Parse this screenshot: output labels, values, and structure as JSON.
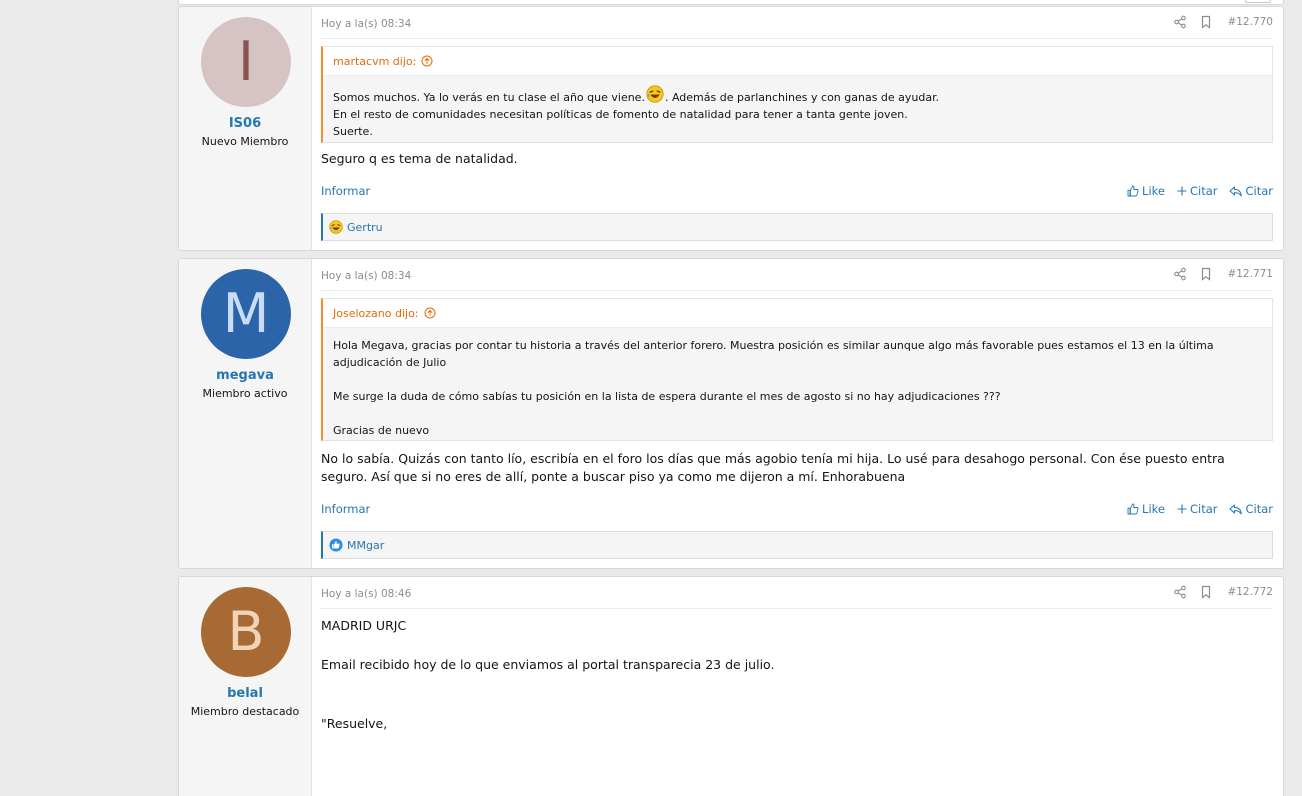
{
  "colors": {
    "link": "#2577b1",
    "quote_accent": "#f78c2b",
    "quote_author": "#e36c09",
    "meta": "#8c8c8c"
  },
  "posts": [
    {
      "avatar_letter": "I",
      "avatar_bg": "#d6c3c3",
      "avatar_fg": "#8a5353",
      "username": "IS06",
      "user_title": "Nuevo Miembro",
      "date": "Hoy a la(s) 08:34",
      "number": "#12.770",
      "quote": {
        "author": "martacvm dijo:",
        "line1a": "Somos muchos. Ya lo verás en tu clase el año que viene.",
        "line1b": ". Además de parlanchines y con ganas de ayudar.",
        "line2": "En el resto de comunidades necesitan políticas de fomento de natalidad para tener a tanta gente joven.",
        "line3": "Suerte."
      },
      "body": "Seguro q es tema de natalidad.",
      "report": "Informar",
      "like": "Like",
      "quote_add": "Citar",
      "reply": "Citar",
      "reaction_user": "Gertru",
      "reaction_icon": "laugh-icon"
    },
    {
      "avatar_letter": "M",
      "avatar_bg": "#2b64a8",
      "avatar_fg": "#c8dcf3",
      "username": "megava",
      "user_title": "Miembro activo",
      "date": "Hoy a la(s) 08:34",
      "number": "#12.771",
      "quote": {
        "author": "Joselozano dijo:",
        "p1": "Hola Megava, gracias por contar tu historia a través del anterior forero. Muestra posición es similar aunque algo más favorable pues estamos el 13 en la última adjudicación de Julio",
        "p2": "Me surge la duda de cómo sabías tu posición en la lista de espera durante el mes de agosto si no hay adjudicaciones ???",
        "p3": "Gracias de nuevo"
      },
      "body": "No lo sabía. Quizás con tanto lío, escribía en el foro los días que más agobio tenía mi hija. Lo usé para desahogo personal. Con ése puesto entra seguro. Así que si no eres de allí, ponte a buscar piso ya como me dijeron a mí. Enhorabuena",
      "report": "Informar",
      "like": "Like",
      "quote_add": "Citar",
      "reply": "Citar",
      "reaction_user": "MMgar",
      "reaction_icon": "thumbs-up-icon"
    },
    {
      "avatar_letter": "B",
      "avatar_bg": "#a86a35",
      "avatar_fg": "#f1d4b6",
      "username": "belal",
      "user_title": "Miembro destacado",
      "date": "Hoy a la(s) 08:46",
      "number": "#12.772",
      "body_p1": "MADRID URJC",
      "body_p2": "Email recibido hoy de lo que enviamos al portal transparecia 23 de julio.",
      "body_p3": "\"Resuelve,"
    }
  ]
}
